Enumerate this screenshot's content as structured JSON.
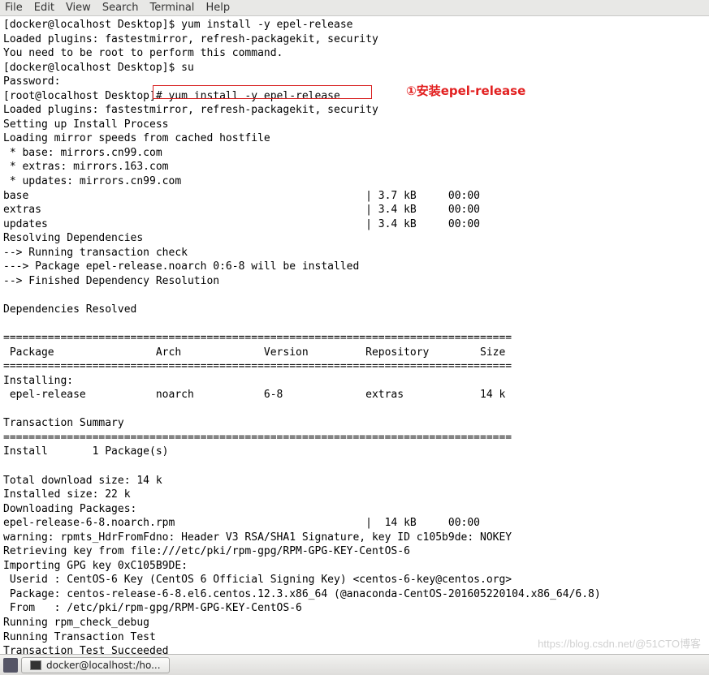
{
  "menu": {
    "file": "File",
    "edit": "Edit",
    "view": "View",
    "search": "Search",
    "terminal": "Terminal",
    "help": "Help"
  },
  "terminal_output": "[docker@localhost Desktop]$ yum install -y epel-release\nLoaded plugins: fastestmirror, refresh-packagekit, security\nYou need to be root to perform this command.\n[docker@localhost Desktop]$ su\nPassword: \n[root@localhost Desktop]# yum install -y epel-release\nLoaded plugins: fastestmirror, refresh-packagekit, security\nSetting up Install Process\nLoading mirror speeds from cached hostfile\n * base: mirrors.cn99.com\n * extras: mirrors.163.com\n * updates: mirrors.cn99.com\nbase                                                     | 3.7 kB     00:00     \nextras                                                   | 3.4 kB     00:00     \nupdates                                                  | 3.4 kB     00:00     \nResolving Dependencies\n--> Running transaction check\n---> Package epel-release.noarch 0:6-8 will be installed\n--> Finished Dependency Resolution\n\nDependencies Resolved\n\n================================================================================\n Package                Arch             Version         Repository        Size\n================================================================================\nInstalling:\n epel-release           noarch           6-8             extras            14 k\n\nTransaction Summary\n================================================================================\nInstall       1 Package(s)\n\nTotal download size: 14 k\nInstalled size: 22 k\nDownloading Packages:\nepel-release-6-8.noarch.rpm                              |  14 kB     00:00     \nwarning: rpmts_HdrFromFdno: Header V3 RSA/SHA1 Signature, key ID c105b9de: NOKEY\nRetrieving key from file:///etc/pki/rpm-gpg/RPM-GPG-KEY-CentOS-6\nImporting GPG key 0xC105B9DE:\n Userid : CentOS-6 Key (CentOS 6 Official Signing Key) <centos-6-key@centos.org>\n Package: centos-release-6-8.el6.centos.12.3.x86_64 (@anaconda-CentOS-201605220104.x86_64/6.8)\n From   : /etc/pki/rpm-gpg/RPM-GPG-KEY-CentOS-6\nRunning rpm_check_debug\nRunning Transaction Test\nTransaction Test Succeeded",
  "annotation": "①安装epel-release",
  "watermark": "https://blog.csdn.net/@51CTO博客",
  "taskbar": {
    "button_label": "docker@localhost:/ho..."
  }
}
